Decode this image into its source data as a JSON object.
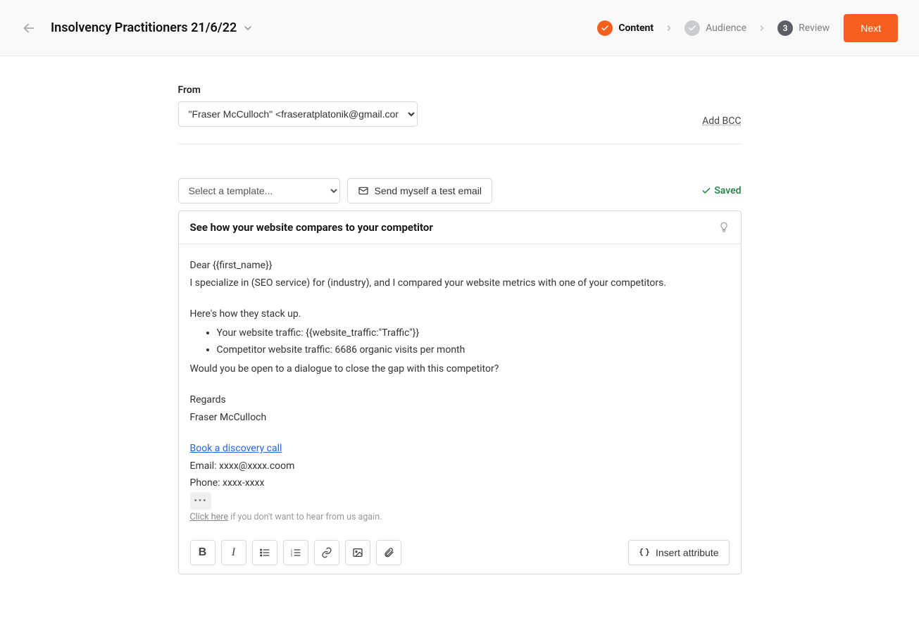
{
  "header": {
    "title": "Insolvency Practitioners 21/6/22"
  },
  "steps": {
    "content": {
      "label": "Content"
    },
    "audience": {
      "label": "Audience"
    },
    "review": {
      "label": "Review",
      "num": "3"
    }
  },
  "actions": {
    "next": "Next",
    "add_bcc": "Add BCC",
    "test_email": "Send myself a test email",
    "insert_attribute": "Insert attribute",
    "saved": "Saved"
  },
  "from": {
    "label": "From",
    "value": "\"Fraser McCulloch\" <fraseratplatonik@gmail.com>"
  },
  "template": {
    "placeholder": "Select a template..."
  },
  "editor": {
    "subject": "See how your website compares to your competitor",
    "greeting": "Dear {{first_name}}",
    "intro": "I specialize in (SEO service) for (industry), and I compared your website metrics with one of your competitors.",
    "stackup": "Here's how they stack up.",
    "bullets": [
      "Your website traffic: {{website_traffic:\"Traffic\"}}",
      "Competitor website traffic: 6686 organic visits  per month"
    ],
    "ask": "Would you be open to a dialogue to close the gap with this competitor?",
    "regards": "Regards",
    "name": "Fraser McCulloch",
    "cta_link": "Book a discovery call",
    "email": "Email: xxxx@xxxx.coom",
    "phone": "Phone: xxxx-xxxx",
    "dots": "•••",
    "unsub_link": "Click here",
    "unsub_rest": " if you don't want to hear from us again."
  }
}
